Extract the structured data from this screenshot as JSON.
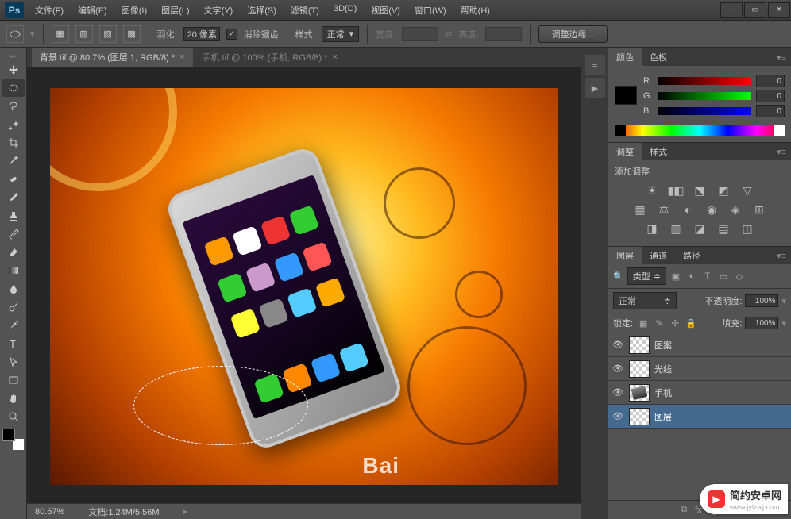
{
  "app": {
    "logo": "Ps"
  },
  "menu": [
    "文件(F)",
    "编辑(E)",
    "图像(I)",
    "图层(L)",
    "文字(Y)",
    "选择(S)",
    "滤镜(T)",
    "3D(D)",
    "视图(V)",
    "窗口(W)",
    "帮助(H)"
  ],
  "options": {
    "feather_label": "羽化:",
    "feather_value": "20 像素",
    "antialias": "消除锯齿",
    "style_label": "样式:",
    "style_value": "正常",
    "width_label": "宽度:",
    "height_label": "高度:",
    "refine_edge": "调整边缘..."
  },
  "tabs": [
    {
      "title": "背景.tif @ 80.7% (图层 1, RGB/8) *",
      "active": true
    },
    {
      "title": "手机.tif @ 100% (手机, RGB/8) *",
      "active": false
    }
  ],
  "status": {
    "zoom": "80.67%",
    "docinfo": "文档:1.24M/5.56M"
  },
  "panels": {
    "color": {
      "tab1": "颜色",
      "tab2": "色板",
      "r_label": "R",
      "r_val": "0",
      "g_label": "G",
      "g_val": "0",
      "b_label": "B",
      "b_val": "0"
    },
    "adjust": {
      "tab1": "调整",
      "tab2": "样式",
      "title": "添加调整"
    },
    "layers": {
      "tab1": "图层",
      "tab2": "通道",
      "tab3": "路径",
      "kind": "类型",
      "blend": "正常",
      "opacity_label": "不透明度:",
      "opacity": "100%",
      "lock_label": "锁定:",
      "fill_label": "填充:",
      "fill": "100%",
      "items": [
        {
          "name": "图案"
        },
        {
          "name": "光线"
        },
        {
          "name": "手机"
        },
        {
          "name": "图层"
        }
      ]
    }
  },
  "watermark": "Bai",
  "brand": {
    "text": "简约安卓网",
    "sub": "www.jylzwj.com",
    "icon": "▶"
  }
}
